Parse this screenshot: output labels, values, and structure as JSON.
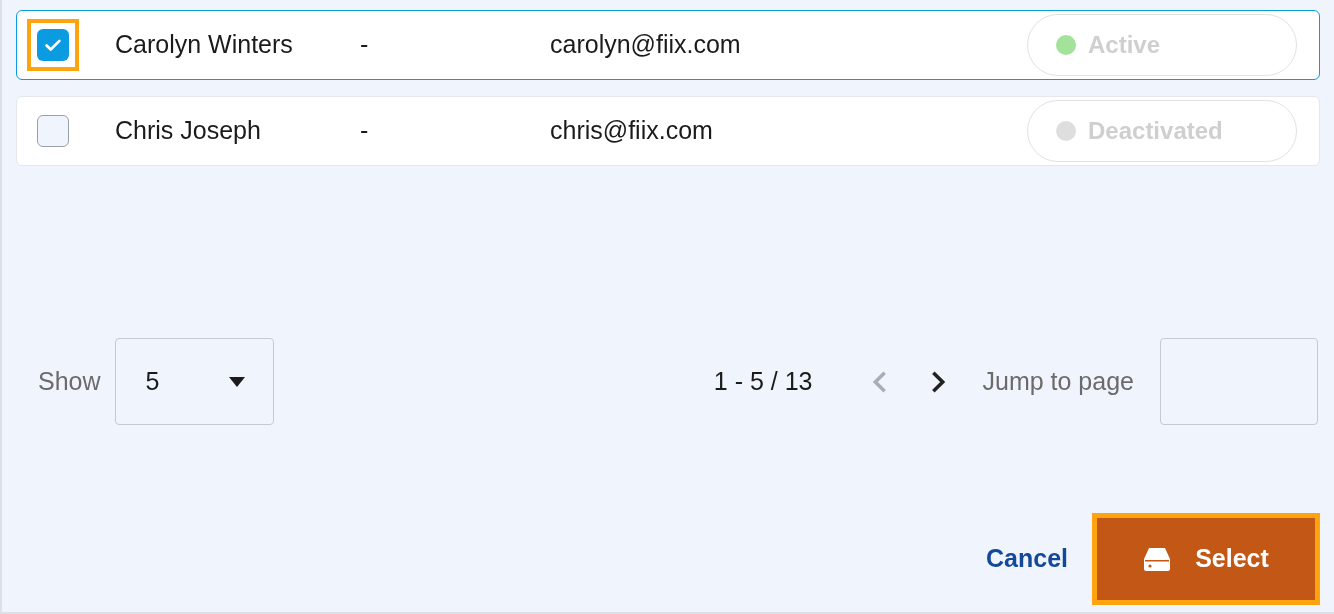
{
  "rows": [
    {
      "checked": true,
      "highlighted": true,
      "name": "Carolyn Winters",
      "column_3": "-",
      "email": "carolyn@fiix.com",
      "status": {
        "label": "Active",
        "color": "#a3e29a"
      }
    },
    {
      "checked": false,
      "highlighted": false,
      "name": "Chris Joseph",
      "column_3": "-",
      "email": "chris@fiix.com",
      "status": {
        "label": "Deactivated",
        "color": "#dedede"
      }
    }
  ],
  "pagination": {
    "show_label": "Show",
    "page_size": "5",
    "range": "1 - 5 / 13",
    "prev_disabled": true,
    "next_disabled": false,
    "jump_label": "Jump to page"
  },
  "footer": {
    "cancel": "Cancel",
    "select": {
      "label": "Select",
      "highlighted": true
    }
  }
}
